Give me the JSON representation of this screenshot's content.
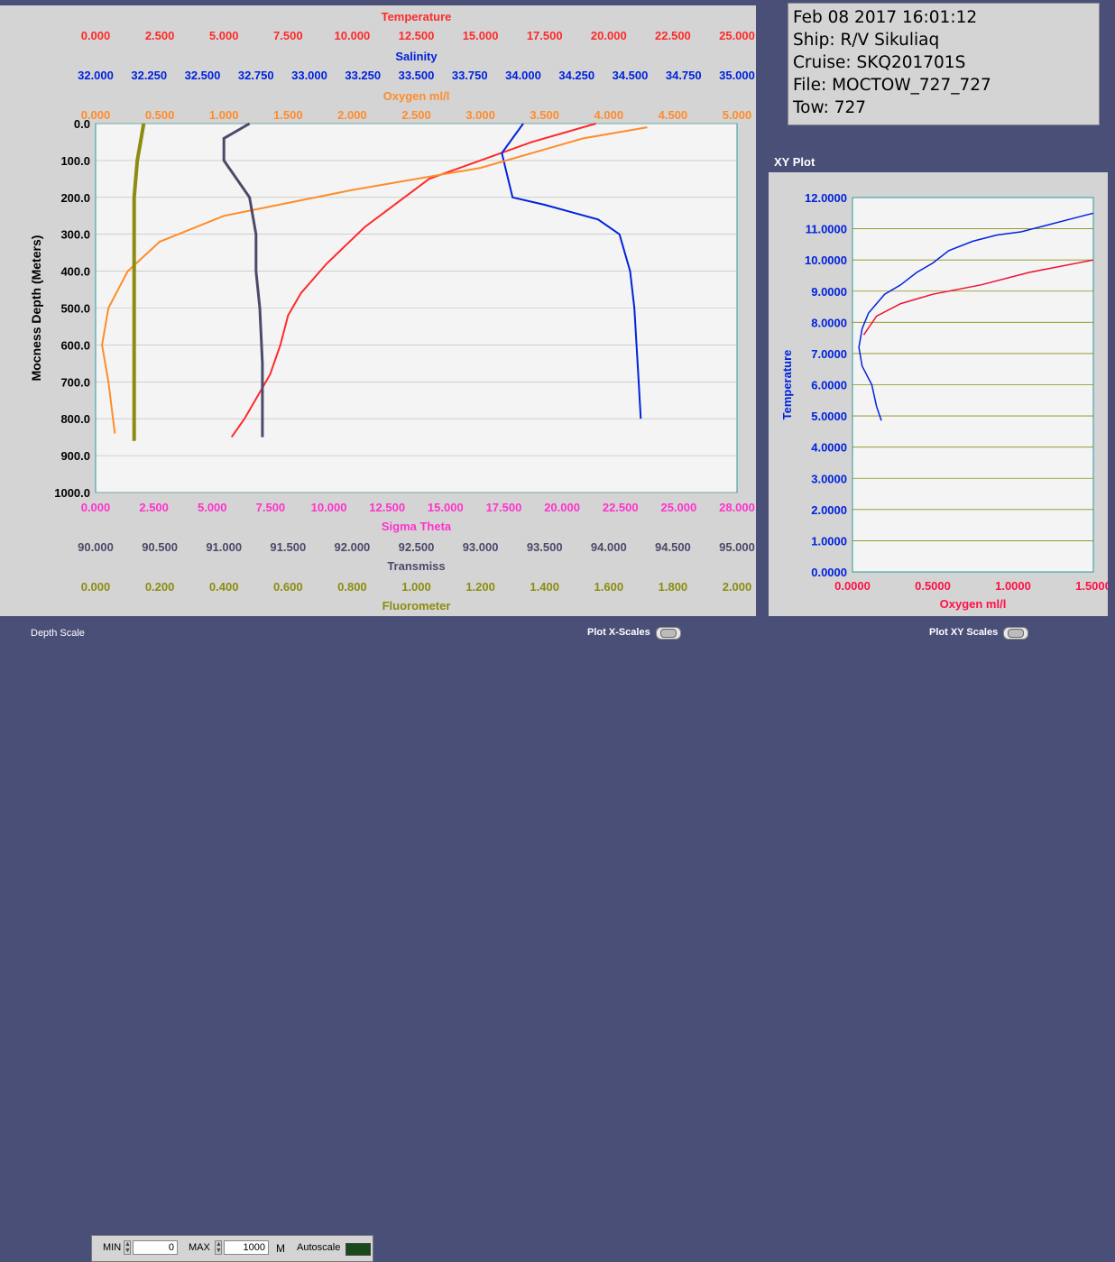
{
  "info": {
    "datetime": "Feb 08 2017 16:01:12",
    "ship": "Ship: R/V Sikuliaq",
    "cruise": "Cruise: SKQ201701S",
    "file": "File: MOCTOW_727_727",
    "tow": "Tow: 727"
  },
  "xy_plot_title": "XY Plot",
  "controls": {
    "depth_scale_label": "Depth Scale",
    "min_label": "MIN",
    "min_value": "0",
    "max_label": "MAX",
    "max_value": "1000",
    "unit": "M",
    "autoscale_label": "Autoscale",
    "plot_x_scales_label": "Plot X-Scales",
    "plot_xy_scales_label": "Plot XY Scales"
  },
  "colors": {
    "temperature": "#ff2a2a",
    "salinity": "#0022dd",
    "oxygen": "#ff8c2a",
    "sigma_theta": "#ff33cc",
    "transmiss": "#4a4a6a",
    "fluorometer": "#8c8c10",
    "plot_bg": "#f4f4f4",
    "grid": "#8c8c10"
  },
  "chart_data": [
    {
      "type": "line",
      "title": "",
      "ylabel": "Mocness Depth (Meters)",
      "y_reversed": true,
      "ylim": [
        0,
        1000
      ],
      "yticks": [
        "0.0",
        "100.0",
        "200.0",
        "300.0",
        "400.0",
        "500.0",
        "600.0",
        "700.0",
        "800.0",
        "900.0",
        "1000.0"
      ],
      "top_axes": [
        {
          "name": "Temperature",
          "color": "#ff2a2a",
          "range": [
            0,
            25
          ],
          "ticks": [
            "0.000",
            "2.500",
            "5.000",
            "7.500",
            "10.000",
            "12.500",
            "15.000",
            "17.500",
            "20.000",
            "22.500",
            "25.000"
          ]
        },
        {
          "name": "Salinity",
          "color": "#0022dd",
          "range": [
            32,
            35
          ],
          "ticks": [
            "32.000",
            "32.250",
            "32.500",
            "32.750",
            "33.000",
            "33.250",
            "33.500",
            "33.750",
            "34.000",
            "34.250",
            "34.500",
            "34.750",
            "35.000"
          ]
        },
        {
          "name": "Oxygen ml/l",
          "color": "#ff8c2a",
          "range": [
            0,
            5
          ],
          "ticks": [
            "0.000",
            "0.500",
            "1.000",
            "1.500",
            "2.000",
            "2.500",
            "3.000",
            "3.500",
            "4.000",
            "4.500",
            "5.000"
          ]
        }
      ],
      "bottom_axes": [
        {
          "name": "Sigma Theta",
          "color": "#ff33cc",
          "range": [
            0,
            28
          ],
          "ticks": [
            "0.000",
            "2.500",
            "5.000",
            "7.500",
            "10.000",
            "12.500",
            "15.000",
            "17.500",
            "20.000",
            "22.500",
            "25.000",
            "28.000"
          ]
        },
        {
          "name": "Transmiss",
          "color": "#4a4a6a",
          "range": [
            90,
            95
          ],
          "ticks": [
            "90.000",
            "90.500",
            "91.000",
            "91.500",
            "92.000",
            "92.500",
            "93.000",
            "93.500",
            "94.000",
            "94.500",
            "95.000"
          ]
        },
        {
          "name": "Fluorometer",
          "color": "#8c8c10",
          "range": [
            0,
            2
          ],
          "ticks": [
            "0.000",
            "0.200",
            "0.400",
            "0.600",
            "0.800",
            "1.000",
            "1.200",
            "1.400",
            "1.600",
            "1.800",
            "2.000"
          ]
        }
      ],
      "series": [
        {
          "name": "Temperature",
          "color": "#ff2a2a",
          "x": [
            19.5,
            17,
            13,
            10.5,
            9,
            8,
            7.5,
            7.2,
            6.8,
            6.3,
            5.8,
            5.3
          ],
          "y": [
            0,
            50,
            150,
            280,
            380,
            460,
            520,
            600,
            680,
            740,
            800,
            850
          ]
        },
        {
          "name": "Salinity",
          "color": "#0022dd",
          "x": [
            34.0,
            33.9,
            33.95,
            34.1,
            34.35,
            34.45,
            34.5,
            34.52,
            34.53,
            34.54,
            34.55
          ],
          "y": [
            0,
            80,
            200,
            220,
            260,
            300,
            400,
            500,
            600,
            700,
            800
          ]
        },
        {
          "name": "Oxygen ml/l",
          "color": "#ff8c2a",
          "x": [
            4.3,
            3.8,
            3.0,
            2.0,
            1.0,
            0.5,
            0.25,
            0.1,
            0.05,
            0.1,
            0.15
          ],
          "y": [
            10,
            40,
            120,
            180,
            250,
            320,
            400,
            500,
            600,
            700,
            840
          ]
        },
        {
          "name": "Transmiss",
          "color": "#4a4a6a",
          "x": [
            91.2,
            91.0,
            91.0,
            91.2,
            91.25,
            91.25,
            91.28,
            91.3,
            91.3
          ],
          "y": [
            0,
            40,
            100,
            200,
            300,
            400,
            500,
            650,
            850
          ]
        },
        {
          "name": "Fluorometer",
          "color": "#8c8c10",
          "x": [
            0.15,
            0.14,
            0.13,
            0.12,
            0.12,
            0.12,
            0.12,
            0.12
          ],
          "y": [
            0,
            50,
            100,
            200,
            300,
            500,
            700,
            860
          ]
        }
      ]
    },
    {
      "type": "scatter",
      "title": "XY Plot",
      "xlabel": "Oxygen ml/l",
      "ylabel": "Temperature",
      "xlim": [
        0,
        1.5
      ],
      "ylim": [
        0,
        12
      ],
      "xticks": [
        "0.0000",
        "0.5000",
        "1.0000",
        "1.5000"
      ],
      "yticks": [
        "0.0000",
        "1.0000",
        "2.0000",
        "3.0000",
        "4.0000",
        "5.0000",
        "6.0000",
        "7.0000",
        "8.0000",
        "9.0000",
        "10.0000",
        "11.0000",
        "12.0000"
      ],
      "series": [
        {
          "name": "blue",
          "color": "#0022dd",
          "x": [
            0.18,
            0.15,
            0.12,
            0.06,
            0.04,
            0.06,
            0.1,
            0.2,
            0.3,
            0.4,
            0.5,
            0.6,
            0.75,
            0.9,
            1.05,
            1.2,
            1.35,
            1.5
          ],
          "y": [
            4.85,
            5.3,
            6.0,
            6.6,
            7.2,
            7.8,
            8.3,
            8.9,
            9.2,
            9.6,
            9.9,
            10.3,
            10.6,
            10.8,
            10.9,
            11.1,
            11.3,
            11.5
          ]
        },
        {
          "name": "red",
          "color": "#ee1133",
          "x": [
            0.07,
            0.15,
            0.3,
            0.5,
            0.8,
            1.1,
            1.5
          ],
          "y": [
            7.6,
            8.2,
            8.6,
            8.9,
            9.2,
            9.6,
            10.0
          ]
        }
      ]
    }
  ]
}
